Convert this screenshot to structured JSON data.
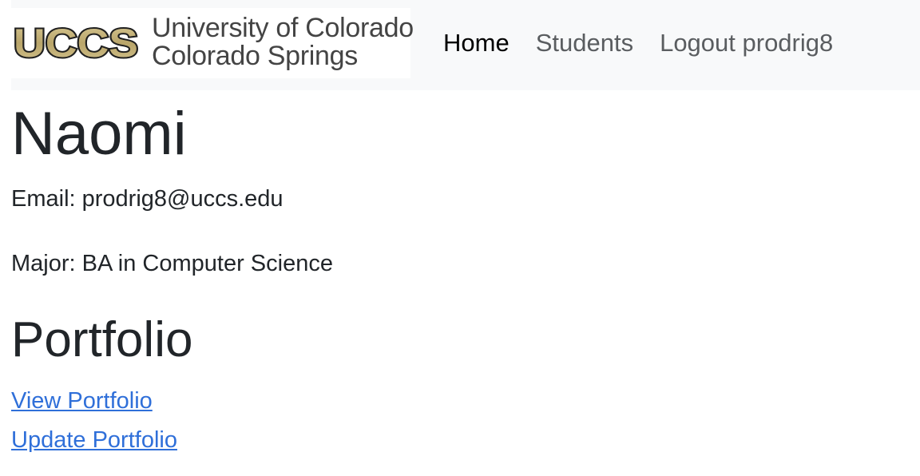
{
  "navbar": {
    "brand": {
      "logo_text": "UCCS",
      "line1": "University of Colorado",
      "line2": "Colorado Springs",
      "logo_fill": "#c4b27a",
      "logo_stroke": "#222222"
    },
    "links": [
      {
        "label": "Home",
        "active": true
      },
      {
        "label": "Students",
        "active": false
      },
      {
        "label": "Logout prodrig8",
        "active": false
      }
    ]
  },
  "profile": {
    "name": "Naomi",
    "email_line": "Email: prodrig8@uccs.edu",
    "major_line": "Major: BA in Computer Science"
  },
  "portfolio": {
    "heading": "Portfolio",
    "view_label": "View Portfolio",
    "update_label": "Update Portfolio"
  },
  "colors": {
    "link": "#2f6fd9",
    "navbar_bg": "#f8f9fa",
    "text": "#212529"
  }
}
